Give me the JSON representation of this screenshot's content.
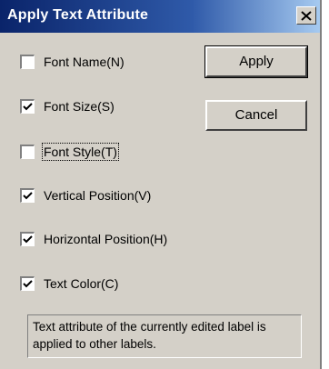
{
  "window": {
    "title": "Apply Text Attribute"
  },
  "checkboxes": [
    {
      "label": "Font Name(N)",
      "checked": false
    },
    {
      "label": "Font Size(S)",
      "checked": true
    },
    {
      "label": "Font Style(T)",
      "checked": false
    },
    {
      "label": "Vertical Position(V)",
      "checked": true
    },
    {
      "label": "Horizontal Position(H)",
      "checked": true
    },
    {
      "label": "Text Color(C)",
      "checked": true
    }
  ],
  "buttons": {
    "apply_label": "Apply",
    "cancel_label": "Cancel"
  },
  "info": {
    "text": "Text attribute of the currently edited label is applied to other labels."
  },
  "icons": {
    "close": "close-icon",
    "check": "checkmark-icon"
  }
}
